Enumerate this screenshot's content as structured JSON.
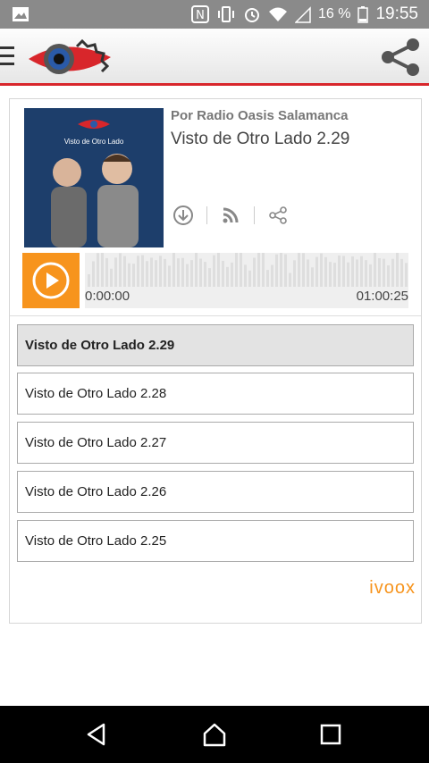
{
  "status": {
    "battery_text": "16 %",
    "time": "19:55",
    "icons": [
      "gallery-icon",
      "nfc-icon",
      "vibrate-icon",
      "alarm-icon",
      "wifi-icon",
      "signal-icon",
      "battery-icon"
    ]
  },
  "appbar": {
    "icons": [
      "menu-icon",
      "app-logo",
      "share-icon"
    ]
  },
  "episode": {
    "author": "Por Radio Oasis Salamanca",
    "title": "Visto de Otro Lado 2.29",
    "cover_text": "Visto de Otro Lado",
    "actions": [
      "download-icon",
      "rss-icon",
      "share-icon"
    ]
  },
  "player": {
    "current_time": "0:00:00",
    "duration": "01:00:25",
    "progress": 0,
    "accent": "#f7941d"
  },
  "playlist": [
    {
      "label": "Visto de Otro Lado 2.29",
      "active": true
    },
    {
      "label": "Visto de Otro Lado 2.28",
      "active": false
    },
    {
      "label": "Visto de Otro Lado 2.27",
      "active": false
    },
    {
      "label": "Visto de Otro Lado 2.26",
      "active": false
    },
    {
      "label": "Visto de Otro Lado 2.25",
      "active": false
    }
  ],
  "branding": {
    "name": "ivoox"
  },
  "colors": {
    "brand_red": "#d8262b",
    "orange": "#f7941d"
  }
}
